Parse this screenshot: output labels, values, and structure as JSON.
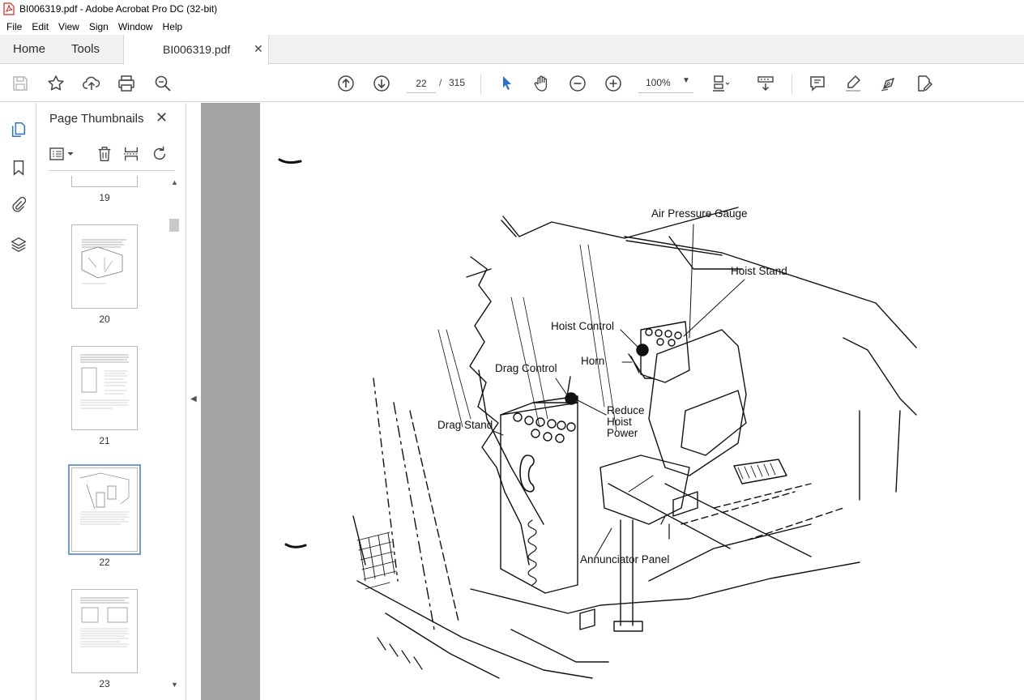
{
  "window": {
    "title": "BI006319.pdf - Adobe Acrobat Pro DC (32-bit)"
  },
  "menu": [
    "File",
    "Edit",
    "View",
    "Sign",
    "Window",
    "Help"
  ],
  "tabs": {
    "home": "Home",
    "tools": "Tools",
    "document": "BI006319.pdf"
  },
  "toolbar": {
    "current_page": "22",
    "separator": "/",
    "total_pages": "315",
    "zoom": "100%"
  },
  "icons": {
    "toolbar": [
      "save-icon",
      "bookmark-star-icon",
      "upload-cloud-icon",
      "print-icon",
      "zoom-search-icon",
      "page-up-icon",
      "page-down-icon",
      "select-cursor-icon",
      "hand-icon",
      "zoom-out-icon",
      "zoom-in-icon",
      "page-fit-icon",
      "scroll-mode-icon",
      "comment-icon",
      "highlight-icon",
      "sign-pen-icon",
      "edit-pdf-icon"
    ],
    "rail": [
      "page-thumbnails-icon",
      "bookmark-icon",
      "attachment-icon",
      "layers-icon"
    ]
  },
  "thumbnails_panel": {
    "title": "Page Thumbnails",
    "pages": [
      {
        "label": "19",
        "selected": false
      },
      {
        "label": "20",
        "selected": false
      },
      {
        "label": "21",
        "selected": false
      },
      {
        "label": "22",
        "selected": true
      },
      {
        "label": "23",
        "selected": false
      }
    ]
  },
  "figure_labels": {
    "air_pressure_gauge": "Air Pressure Gauge",
    "hoist_stand": "Hoist Stand",
    "hoist_control": "Hoist Control",
    "horn": "Horn",
    "drag_control": "Drag Control",
    "reduce_hoist_power_1": "Reduce",
    "reduce_hoist_power_2": "Hoist",
    "reduce_hoist_power_3": "Power",
    "drag_stand": "Drag Stand",
    "annunciator_panel": "Annunciator Panel"
  },
  "colors": {
    "accent_blue": "#2c6fd1",
    "selected_thumb_outline": "#6f9bd0",
    "doc_background": "#a3a3a3",
    "pdf_icon_red": "#d4281e"
  }
}
